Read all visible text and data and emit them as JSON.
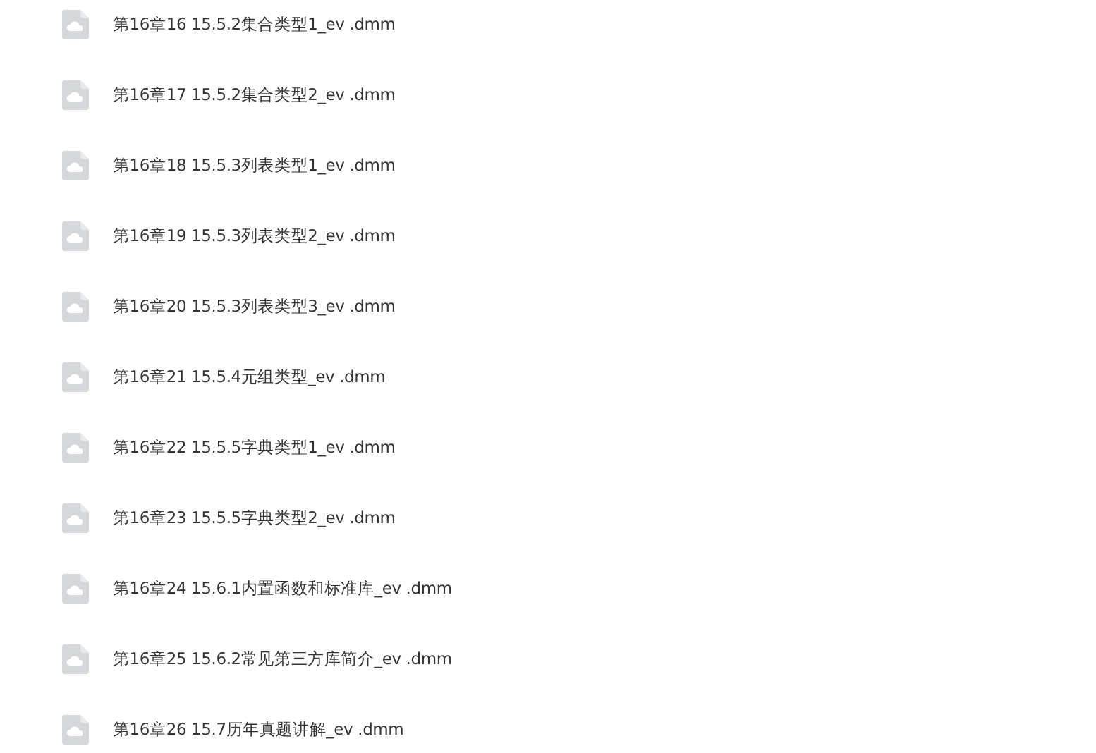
{
  "files": [
    {
      "name": "第16章16 15.5.2集合类型1_ev .dmm"
    },
    {
      "name": "第16章17 15.5.2集合类型2_ev .dmm"
    },
    {
      "name": "第16章18 15.5.3列表类型1_ev .dmm"
    },
    {
      "name": "第16章19 15.5.3列表类型2_ev .dmm"
    },
    {
      "name": "第16章20 15.5.3列表类型3_ev .dmm"
    },
    {
      "name": "第16章21 15.5.4元组类型_ev .dmm"
    },
    {
      "name": "第16章22 15.5.5字典类型1_ev .dmm"
    },
    {
      "name": "第16章23 15.5.5字典类型2_ev .dmm"
    },
    {
      "name": "第16章24 15.6.1内置函数和标准库_ev .dmm"
    },
    {
      "name": "第16章25 15.6.2常见第三方库简介_ev .dmm"
    },
    {
      "name": "第16章26 15.7历年真题讲解_ev .dmm"
    }
  ]
}
